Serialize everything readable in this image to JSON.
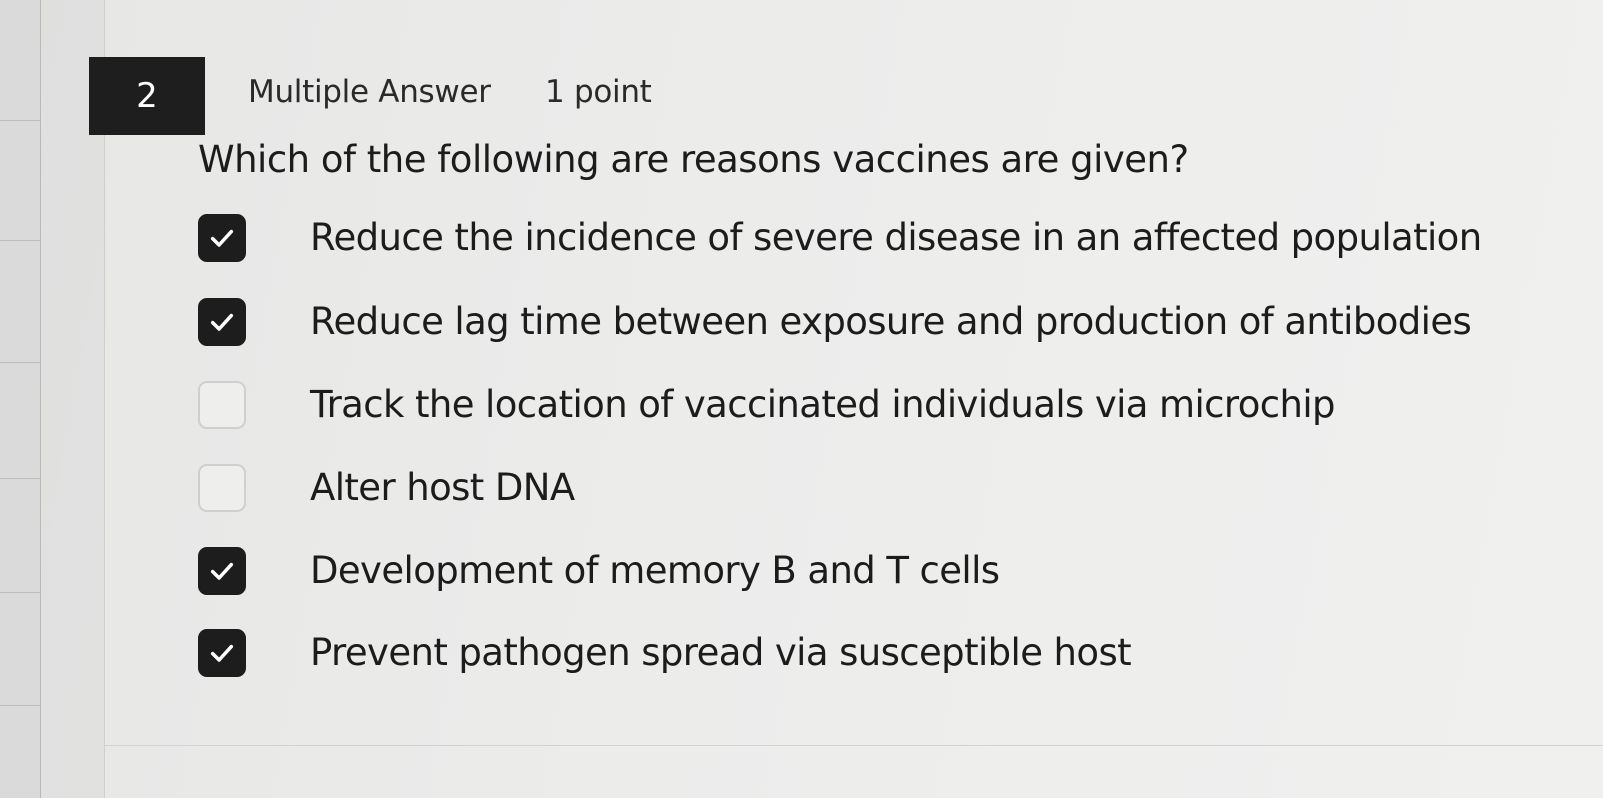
{
  "question": {
    "number": "2",
    "type": "Multiple Answer",
    "points": "1 point",
    "prompt": "Which of the following are reasons vaccines are given?"
  },
  "options": [
    {
      "label": "Reduce the incidence of severe disease in an affected population",
      "checked": true
    },
    {
      "label": "Reduce lag time between exposure and production of antibodies",
      "checked": true
    },
    {
      "label": "Track the location of vaccinated individuals via microchip",
      "checked": false
    },
    {
      "label": "Alter host DNA",
      "checked": false
    },
    {
      "label": "Development of memory B and T cells",
      "checked": true
    },
    {
      "label": "Prevent pathogen spread via susceptible host",
      "checked": true
    }
  ],
  "icons": {
    "checked": "checkmark-icon",
    "unchecked": "empty-box"
  },
  "colors": {
    "checked_box": "#1d1d1d",
    "number_badge": "#1e1e1e"
  }
}
